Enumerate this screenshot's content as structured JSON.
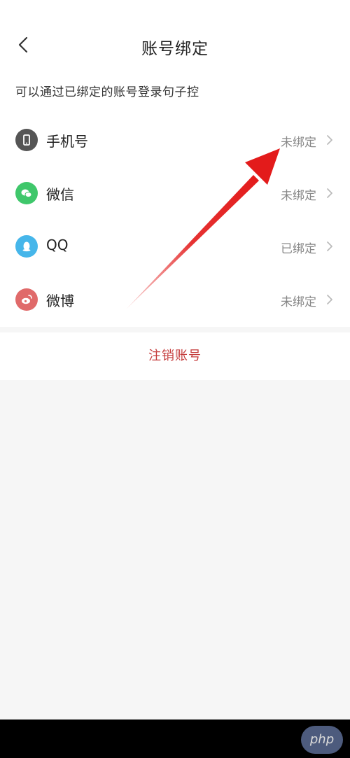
{
  "nav": {
    "title": "账号绑定"
  },
  "subtitle": "可以通过已绑定的账号登录句子控",
  "accounts": [
    {
      "name": "手机号",
      "status": "未绑定",
      "icon": "phone-icon",
      "color": "#555555"
    },
    {
      "name": "微信",
      "status": "未绑定",
      "icon": "wechat-icon",
      "color": "#3fc76b"
    },
    {
      "name": "QQ",
      "status": "已绑定",
      "icon": "qq-icon",
      "color": "#46b6ea"
    },
    {
      "name": "微博",
      "status": "未绑定",
      "icon": "weibo-icon",
      "color": "#e06a6a"
    }
  ],
  "logout_label": "注销账号",
  "watermark": "php",
  "colors": {
    "accent_red": "#c43b3b",
    "annotation_arrow": "#e31b1b"
  }
}
